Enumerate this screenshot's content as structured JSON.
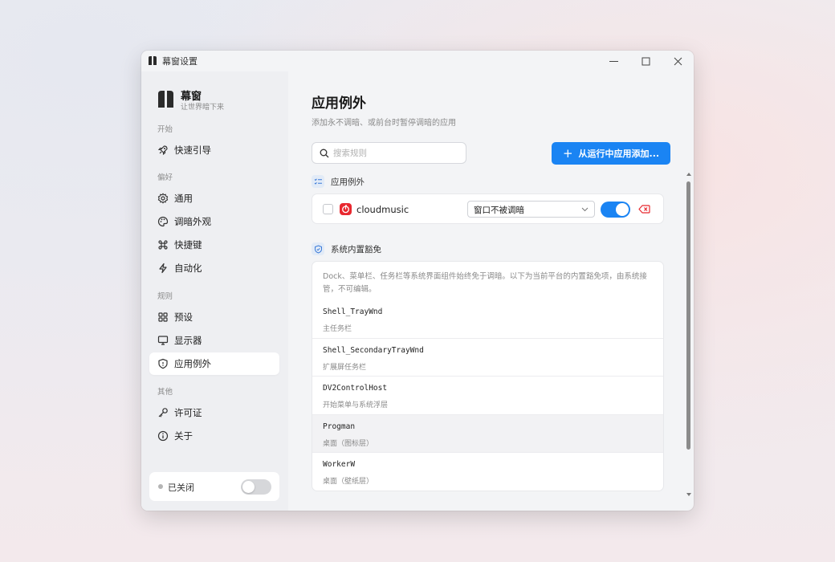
{
  "window": {
    "title": "幕窗设置"
  },
  "brand": {
    "name": "幕窗",
    "tagline": "让世界暗下来"
  },
  "sidebar": {
    "sections": {
      "start": "开始",
      "prefs": "偏好",
      "rules": "规则",
      "other": "其他"
    },
    "items": [
      {
        "id": "guide",
        "label": "快速引导",
        "icon": "rocket-icon"
      },
      {
        "id": "general",
        "label": "通用",
        "icon": "gear-icon"
      },
      {
        "id": "appearance",
        "label": "调暗外观",
        "icon": "palette-icon"
      },
      {
        "id": "shortcuts",
        "label": "快捷键",
        "icon": "command-icon"
      },
      {
        "id": "automation",
        "label": "自动化",
        "icon": "lightning-icon"
      },
      {
        "id": "presets",
        "label": "预设",
        "icon": "grid-icon"
      },
      {
        "id": "displays",
        "label": "显示器",
        "icon": "monitor-icon"
      },
      {
        "id": "exceptions",
        "label": "应用例外",
        "icon": "shield-icon",
        "active": true
      },
      {
        "id": "license",
        "label": "许可证",
        "icon": "key-icon"
      },
      {
        "id": "about",
        "label": "关于",
        "icon": "info-icon"
      }
    ],
    "status": {
      "label": "已关闭",
      "enabled": false
    }
  },
  "main": {
    "title": "应用例外",
    "subtitle": "添加永不调暗、或前台时暂停调暗的应用",
    "search": {
      "placeholder": "搜索规则",
      "value": ""
    },
    "add_button": "从运行中应用添加...",
    "exceptions_group": {
      "label": "应用例外",
      "rules": [
        {
          "app": "cloudmusic",
          "mode": "窗口不被调暗",
          "enabled": true,
          "checked": false,
          "icon_color": "#e8282f"
        }
      ]
    },
    "builtin_group": {
      "label": "系统内置豁免",
      "description": "Dock、菜单栏、任务栏等系统界面组件始终免于调暗。以下为当前平台的内置豁免项，由系统接管，不可编辑。",
      "entries": [
        {
          "name": "Shell_TrayWnd",
          "desc": "主任务栏"
        },
        {
          "name": "Shell_SecondaryTrayWnd",
          "desc": "扩展屏任务栏"
        },
        {
          "name": "DV2ControlHost",
          "desc": "开始菜单与系统浮层"
        },
        {
          "name": "Progman",
          "desc": "桌面（图标层）"
        },
        {
          "name": "WorkerW",
          "desc": "桌面（壁纸层）"
        }
      ]
    }
  },
  "colors": {
    "accent": "#1a84f3",
    "danger": "#e8282f",
    "active_nav": "#ffffff"
  }
}
